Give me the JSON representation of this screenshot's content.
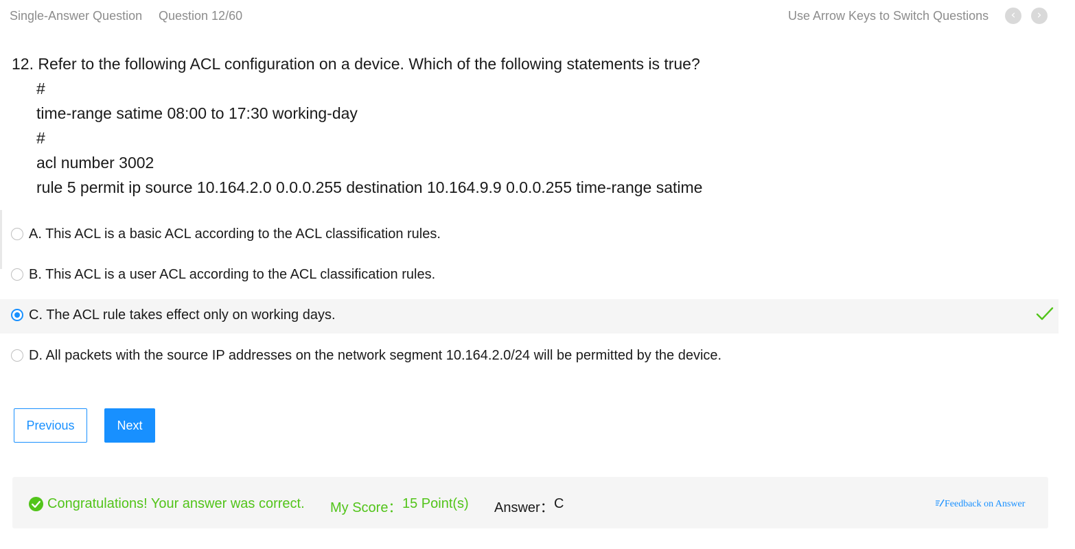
{
  "header": {
    "question_type": "Single-Answer Question",
    "question_count": "Question 12/60",
    "nav_hint": "Use Arrow Keys to Switch Questions",
    "prev_icon": "chevron-left-icon",
    "next_icon": "chevron-right-icon"
  },
  "question": {
    "title": "12. Refer to the following ACL configuration on a device. Which of the following statements is true?",
    "code_lines": [
      "#",
      "time-range satime 08:00 to 17:30 working-day",
      "#",
      "acl number 3002",
      "rule 5 permit ip source 10.164.2.0 0.0.0.255 destination 10.164.9.9 0.0.0.255 time-range satime"
    ]
  },
  "options": [
    {
      "text": "A. This ACL is a basic ACL according to the ACL classification rules.",
      "selected": false
    },
    {
      "text": "B. This ACL is a user ACL according to the ACL classification rules.",
      "selected": false
    },
    {
      "text": "C. The ACL rule takes effect only on working days.",
      "selected": true,
      "correct": true
    },
    {
      "text": "D. All packets with the source IP addresses on the network segment 10.164.2.0/24 will be permitted by the device.",
      "selected": false
    }
  ],
  "buttons": {
    "previous": "Previous",
    "next": "Next"
  },
  "result": {
    "message": "Congratulations! Your answer was correct.",
    "score_label": "My Score：",
    "score_value": "15 Point(s)",
    "answer_label": "Answer：",
    "answer_value": "C",
    "feedback_link": "Feedback on Answer"
  },
  "colors": {
    "accent": "#1890ff",
    "success": "#52c41a",
    "muted_text": "#8c8c8c",
    "selected_row_bg": "#f5f5f5"
  }
}
